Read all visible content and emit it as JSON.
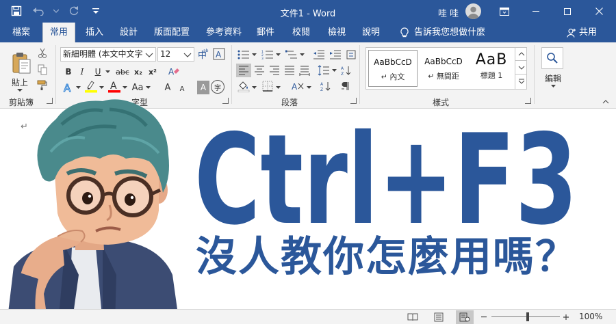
{
  "window": {
    "title": "文件1 - Word",
    "user_name": "哇 哇"
  },
  "tabs": [
    {
      "label": "檔案",
      "active": false
    },
    {
      "label": "常用",
      "active": true
    },
    {
      "label": "插入",
      "active": false
    },
    {
      "label": "設計",
      "active": false
    },
    {
      "label": "版面配置",
      "active": false
    },
    {
      "label": "參考資料",
      "active": false
    },
    {
      "label": "郵件",
      "active": false
    },
    {
      "label": "校閱",
      "active": false
    },
    {
      "label": "檢視",
      "active": false
    },
    {
      "label": "說明",
      "active": false
    }
  ],
  "tell_me": "告訴我您想做什麼",
  "share_label": "共用",
  "ribbon": {
    "clipboard": {
      "paste_label": "貼上",
      "group_label": "剪貼簿"
    },
    "font": {
      "font_name": "新細明體 (本文中文字",
      "font_size": "12",
      "group_label": "字型",
      "bold": "B",
      "italic": "I",
      "underline": "U",
      "strike": "abc",
      "subscript": "x₂",
      "superscript": "x²",
      "grow": "A",
      "shrink": "A",
      "case": "Aa",
      "clear_format": "A",
      "char_shading": "A",
      "phonetic": "字"
    },
    "paragraph": {
      "group_label": "段落"
    },
    "styles": {
      "group_label": "樣式",
      "items": [
        {
          "sample": "AaBbCcD",
          "name": "↵ 內文"
        },
        {
          "sample": "AaBbCcD",
          "name": "↵ 無間距"
        },
        {
          "sample": "AaB",
          "name": "標題 1"
        }
      ]
    },
    "editing": {
      "label": "編輯"
    }
  },
  "document": {
    "headline": "Ctrl+F3",
    "subline": "沒人教你怎麼用嗎？",
    "paragraph_mark": "↵"
  },
  "statusbar": {
    "zoom": "100%",
    "zoom_level": 1.0
  },
  "colors": {
    "word_blue": "#2b579a",
    "ribbon_bg": "#f3f3f3",
    "highlight_yellow": "#ffff00",
    "font_red": "#ff0000"
  }
}
